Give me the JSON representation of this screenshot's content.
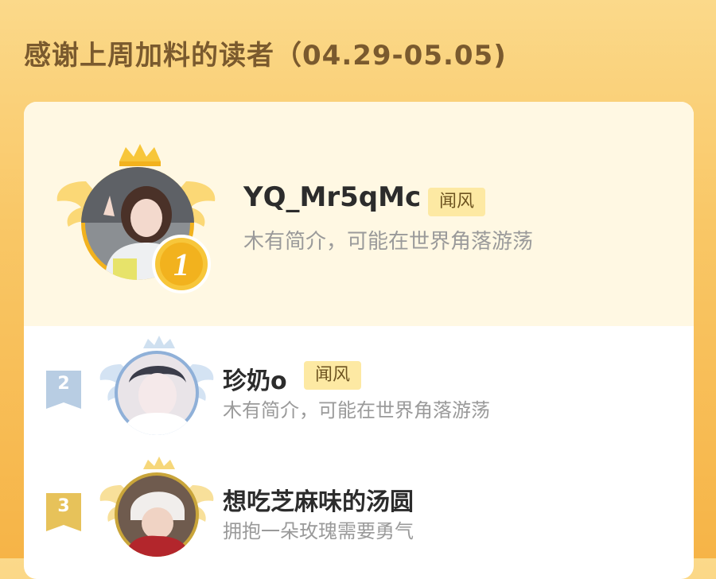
{
  "header": {
    "title": "感谢上周加料的读者（04.29-05.05)"
  },
  "colors": {
    "accent": "#f6b447",
    "badge_bg": "#fde9a3",
    "gold": "#f2b21e",
    "silver": "#b8cde3",
    "bronze": "#e7c25a"
  },
  "readers": [
    {
      "rank": "1",
      "name": "YQ_Mr5qMc",
      "badge": "闻风",
      "bio": "木有简介，可能在世界角落游荡"
    },
    {
      "rank": "2",
      "name": "珍奶o",
      "badge": "闻风",
      "bio": "木有简介，可能在世界角落游荡"
    },
    {
      "rank": "3",
      "name": "想吃芝麻味的汤圆",
      "bio": "拥抱一朵玫瑰需要勇气"
    }
  ]
}
